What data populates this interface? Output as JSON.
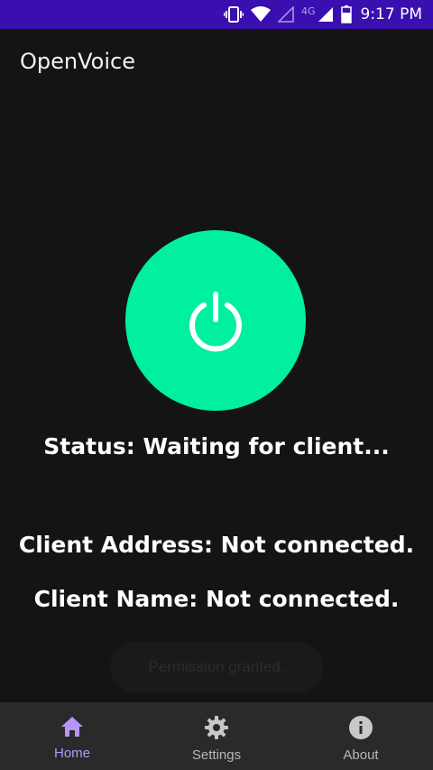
{
  "status_bar": {
    "network": "4G",
    "time": "9:17 PM"
  },
  "app": {
    "title": "OpenVoice"
  },
  "power_button": {
    "icon": "power-icon",
    "color": "#00f0a0"
  },
  "status": {
    "text": "Status: Waiting for client..."
  },
  "client": {
    "address": "Client Address: Not connected.",
    "name": "Client Name: Not connected."
  },
  "toast": {
    "text": "Permission granted."
  },
  "nav": {
    "items": [
      {
        "label": "Home",
        "icon": "home-icon",
        "active": true
      },
      {
        "label": "Settings",
        "icon": "gear-icon",
        "active": false
      },
      {
        "label": "About",
        "icon": "info-icon",
        "active": false
      }
    ]
  },
  "colors": {
    "accent": "#b794f6",
    "status_bar": "#3a0fb0",
    "background": "#141414"
  }
}
